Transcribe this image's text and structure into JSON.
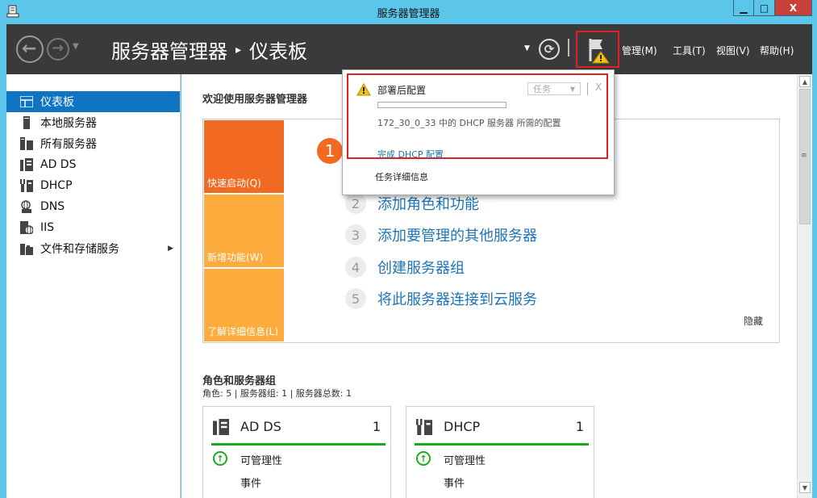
{
  "window": {
    "title": "服务器管理器",
    "min": "▁",
    "max": "□",
    "close": "X"
  },
  "header": {
    "breadcrumb_app": "服务器管理器",
    "breadcrumb_sep": "▸",
    "breadcrumb_page": "仪表板",
    "refresh_glyph": "⟳",
    "menus": [
      "管理(M)",
      "工具(T)",
      "视图(V)",
      "帮助(H)"
    ]
  },
  "sidebar": {
    "items": [
      {
        "label": "仪表板"
      },
      {
        "label": "本地服务器"
      },
      {
        "label": "所有服务器"
      },
      {
        "label": "AD DS"
      },
      {
        "label": "DHCP"
      },
      {
        "label": "DNS"
      },
      {
        "label": "IIS"
      },
      {
        "label": "文件和存储服务"
      }
    ]
  },
  "welcome": {
    "title": "欢迎使用服务器管理器",
    "tiles": [
      "快速启动(Q)",
      "新增功能(W)",
      "了解详细信息(L)"
    ],
    "step1": "1",
    "steps": [
      {
        "num": "2",
        "text": "添加角色和功能"
      },
      {
        "num": "3",
        "text": "添加要管理的其他服务器"
      },
      {
        "num": "4",
        "text": "创建服务器组"
      },
      {
        "num": "5",
        "text": "将此服务器连接到云服务"
      }
    ],
    "hide": "隐藏"
  },
  "roles": {
    "title": "角色和服务器组",
    "subtitle": "角色: 5 | 服务器组: 1 | 服务器总数: 1",
    "cards": [
      {
        "name": "AD DS",
        "count": "1",
        "manageability": "可管理性",
        "events": "事件"
      },
      {
        "name": "DHCP",
        "count": "1",
        "manageability": "可管理性",
        "events": "事件"
      }
    ]
  },
  "popup": {
    "title": "部署后配置",
    "task_label": "任务",
    "close": "X",
    "progress": 0,
    "description": "172_30_0_33 中的 DHCP 服务器 所需的配置",
    "link": "完成 DHCP 配置",
    "details": "任务详细信息"
  },
  "colors": {
    "accent": "#0f74c2",
    "tile_primary": "#f26a21",
    "tile_secondary": "#fcab3c",
    "link": "#1e74b6",
    "status_ok": "#1bab1b",
    "highlight": "#e02020"
  }
}
